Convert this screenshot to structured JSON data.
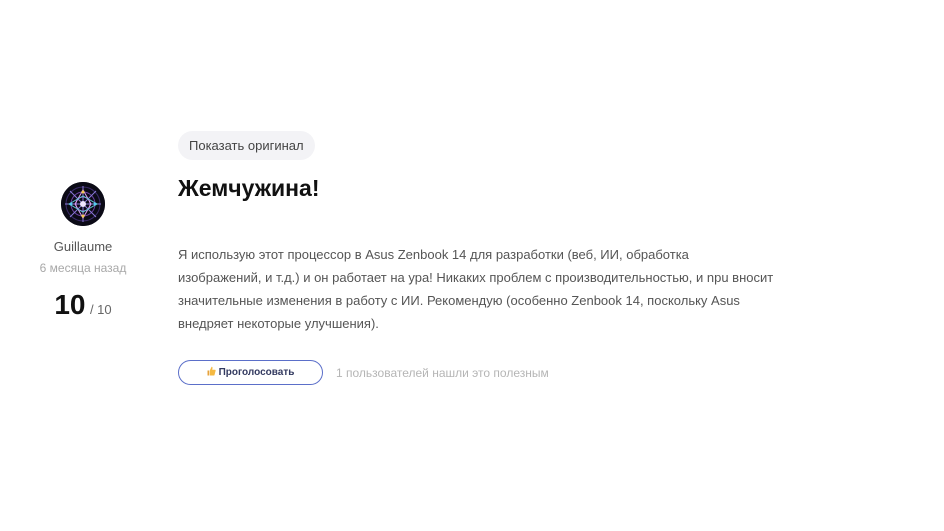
{
  "author": {
    "name": "Guillaume",
    "date": "6 месяца назад",
    "avatar_icon": "mandala-avatar"
  },
  "rating": {
    "score": "10",
    "max": "/ 10"
  },
  "review": {
    "show_original_label": "Показать оригинал",
    "title": "Жемчужина!",
    "body": "Я использую этот процессор в Asus Zenbook 14 для разработки (веб, ИИ, обработка изображений, и т.д.) и он работает на ура! Никаких проблем с производительностью, и npu вносит значительные изменения в работу с ИИ. Рекомендую (особенно Zenbook 14, поскольку Asus внедряет некоторые улучшения)."
  },
  "actions": {
    "vote_label": "Проголосовать",
    "vote_icon": "thumbs-up-icon",
    "helpful_text": "1 пользователей нашли это полезным"
  },
  "colors": {
    "vote_border": "#5b6fc9",
    "pill_background": "#f3f3f6",
    "muted_text": "#b5b5b5"
  }
}
